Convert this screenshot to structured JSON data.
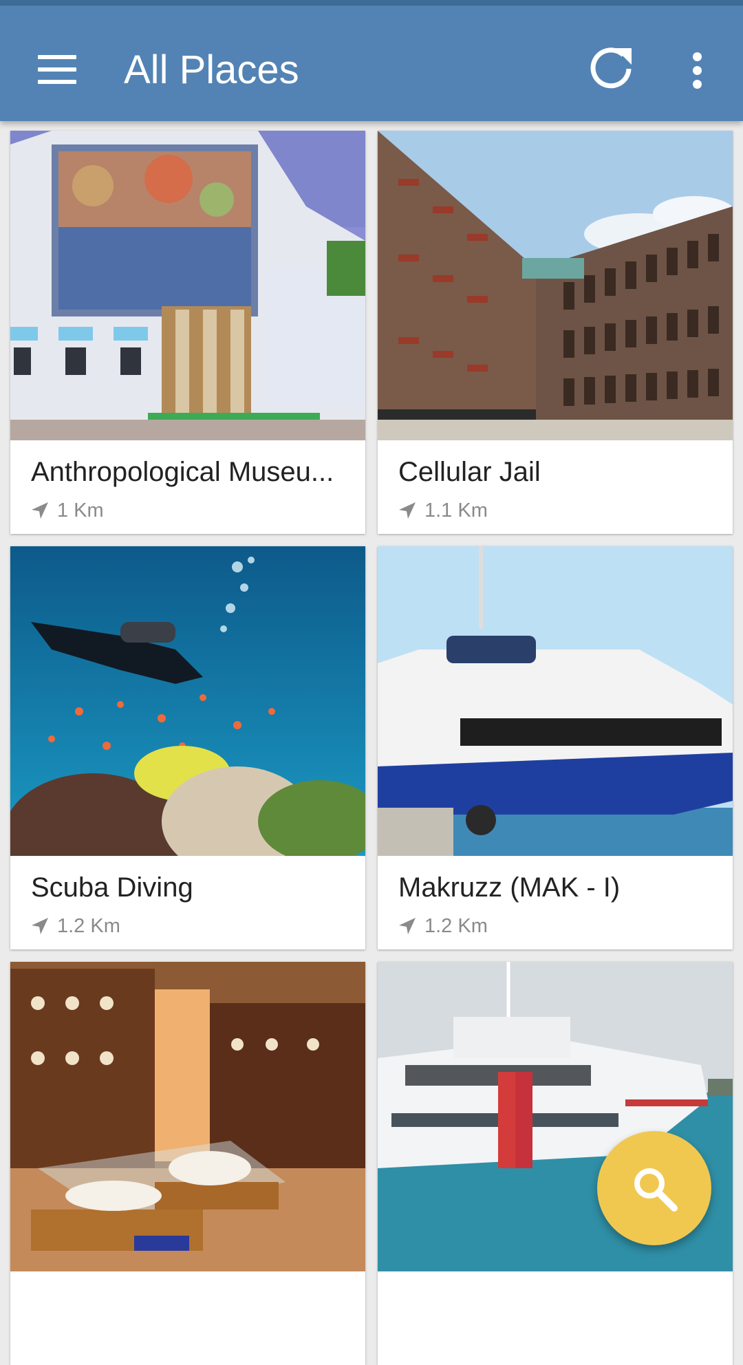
{
  "status_bar": {
    "color": "#3e6c98"
  },
  "app_bar": {
    "title": "All Places",
    "background": "#5383b4",
    "icons": {
      "menu": "hamburger-menu-icon",
      "refresh": "refresh-icon",
      "more": "more-vert-icon"
    }
  },
  "places": [
    {
      "name": "Anthropological Museu...",
      "distance": "1 Km",
      "image": "museum-building-photo"
    },
    {
      "name": "Cellular Jail",
      "distance": "1.1 Km",
      "image": "jail-building-photo"
    },
    {
      "name": "Scuba Diving",
      "distance": "1.2 Km",
      "image": "underwater-diver-photo"
    },
    {
      "name": "Makruzz (MAK - I)",
      "distance": "1.2 Km",
      "image": "catamaran-ferry-photo"
    },
    {
      "name": "",
      "distance": "",
      "image": "shell-museum-interior-photo"
    },
    {
      "name": "",
      "distance": "",
      "image": "green-ocean-ship-photo"
    }
  ],
  "fab": {
    "icon": "search-icon",
    "color": "#f0c850"
  }
}
